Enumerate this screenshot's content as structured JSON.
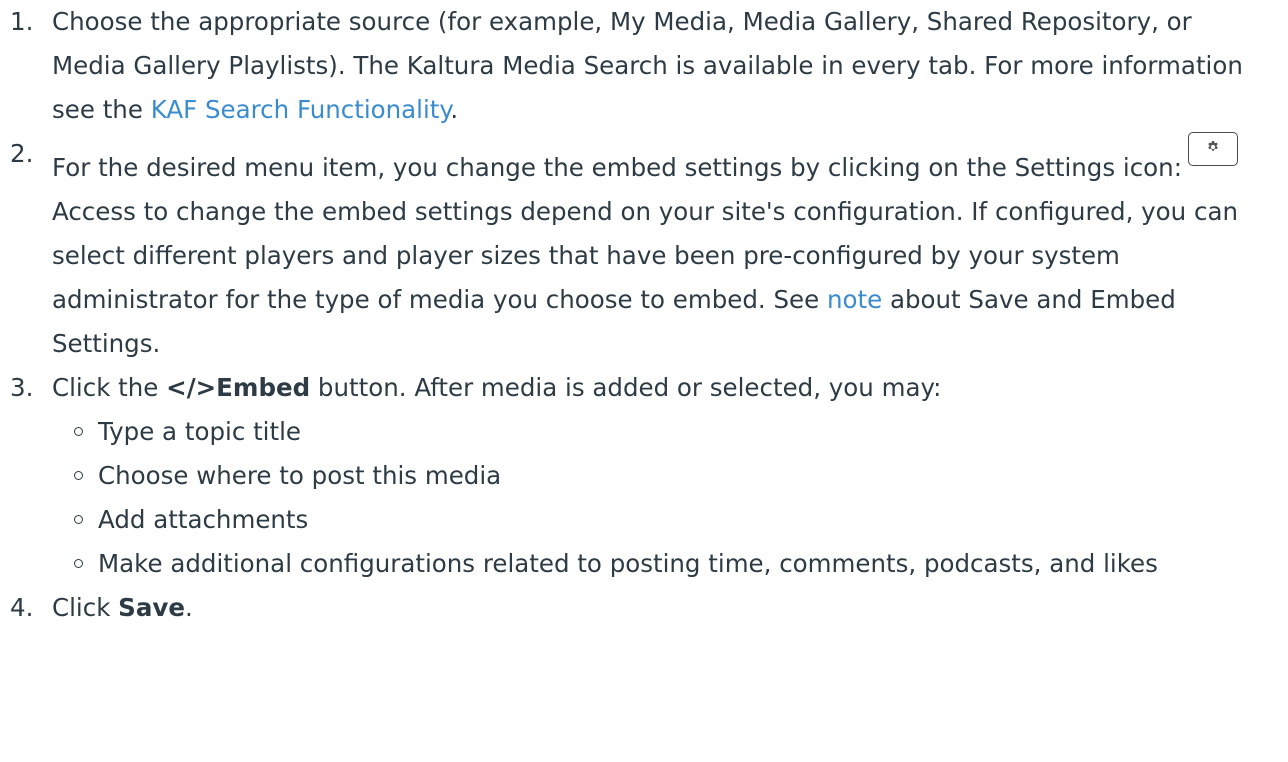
{
  "steps": [
    {
      "number": "1.",
      "text_a": "Choose the appropriate source (for example, My Media, Media Gallery, Shared Repository, or Media Gallery Playlists). The Kaltura Media Search is available in every tab. For more information see the ",
      "link": "KAF Search Functionality",
      "text_b": "."
    },
    {
      "number": "2.",
      "text_a": "For the desired menu item, you change the embed settings by clicking on the Settings icon:",
      "icon": "gear-icon",
      "text_b": "Access to change the embed settings depend on your site's configuration. If configured, you can select different players and player sizes that have been pre-configured by your system administrator for the type of media you choose to embed. See ",
      "link": "note",
      "text_c": " about Save and Embed Settings."
    },
    {
      "number": "3.",
      "text_a": "Click the ",
      "bold": "</>Embed",
      "text_b": " button. After media is added or selected, you may:",
      "subitems": [
        "Type a topic title",
        "Choose where to post this media",
        "Add attachments",
        "Make additional configurations related to posting time, comments, podcasts, and likes"
      ]
    },
    {
      "number": "4.",
      "text_a": "Click ",
      "bold": "Save",
      "text_b": "."
    }
  ],
  "colors": {
    "text": "#2d3b45",
    "link": "#3a8ccf"
  }
}
